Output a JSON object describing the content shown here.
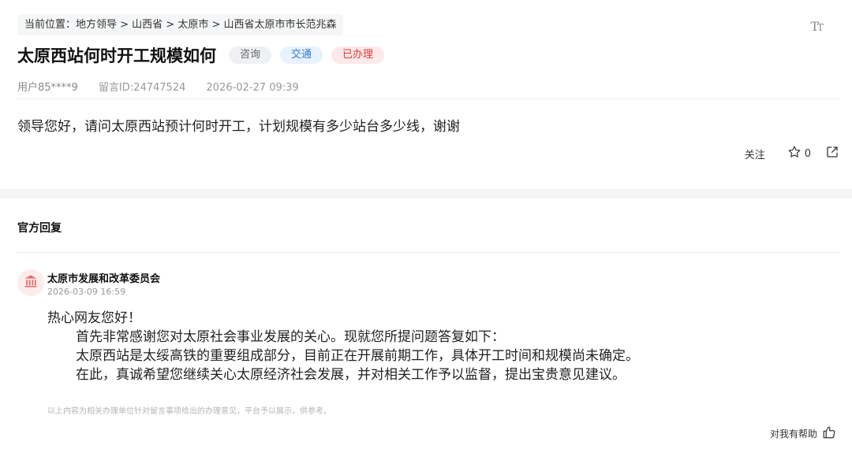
{
  "breadcrumb": "当前位置：地方领导 > 山西省 > 太原市 > 山西省太原市市长范兆森",
  "font_toggle": {
    "big": "T",
    "small": "T"
  },
  "post": {
    "title": "太原西站何时开工规模如何",
    "tags": [
      "咨询",
      "交通",
      "已办理"
    ],
    "user": "用户85****9",
    "message_id": "留言ID:24747524",
    "datetime": "2026-02-27 09:39",
    "content": "领导您好，请问太原西站预计何时开工，计划规模有多少站台多少线，谢谢"
  },
  "actions": {
    "follow_label": "关注",
    "star_count": "0"
  },
  "reply_section": {
    "heading": "官方回复",
    "org_name": "太原市发展和改革委员会",
    "date": "2026-03-09 16:59",
    "greeting": "热心网友您好！",
    "paragraphs": [
      "首先非常感谢您对太原社会事业发展的关心。现就您所提问题答复如下：",
      "太原西站是太绥高铁的重要组成部分，目前正在开展前期工作，具体开工时间和规模尚未确定。",
      "在此，真诚希望您继续关心太原经济社会发展，并对相关工作予以监督，提出宝贵意见建议。"
    ],
    "disclaimer": "以上内容为相关办理单位针对留言事项给出的办理意见，平台予以展示，供参考。",
    "helpful_label": "对我有帮助"
  },
  "colors": {
    "tag_consult": "#666666",
    "tag_traffic": "#2f7bd0",
    "tag_done": "#e0393b",
    "avatar_accent": "#e86b6b"
  }
}
